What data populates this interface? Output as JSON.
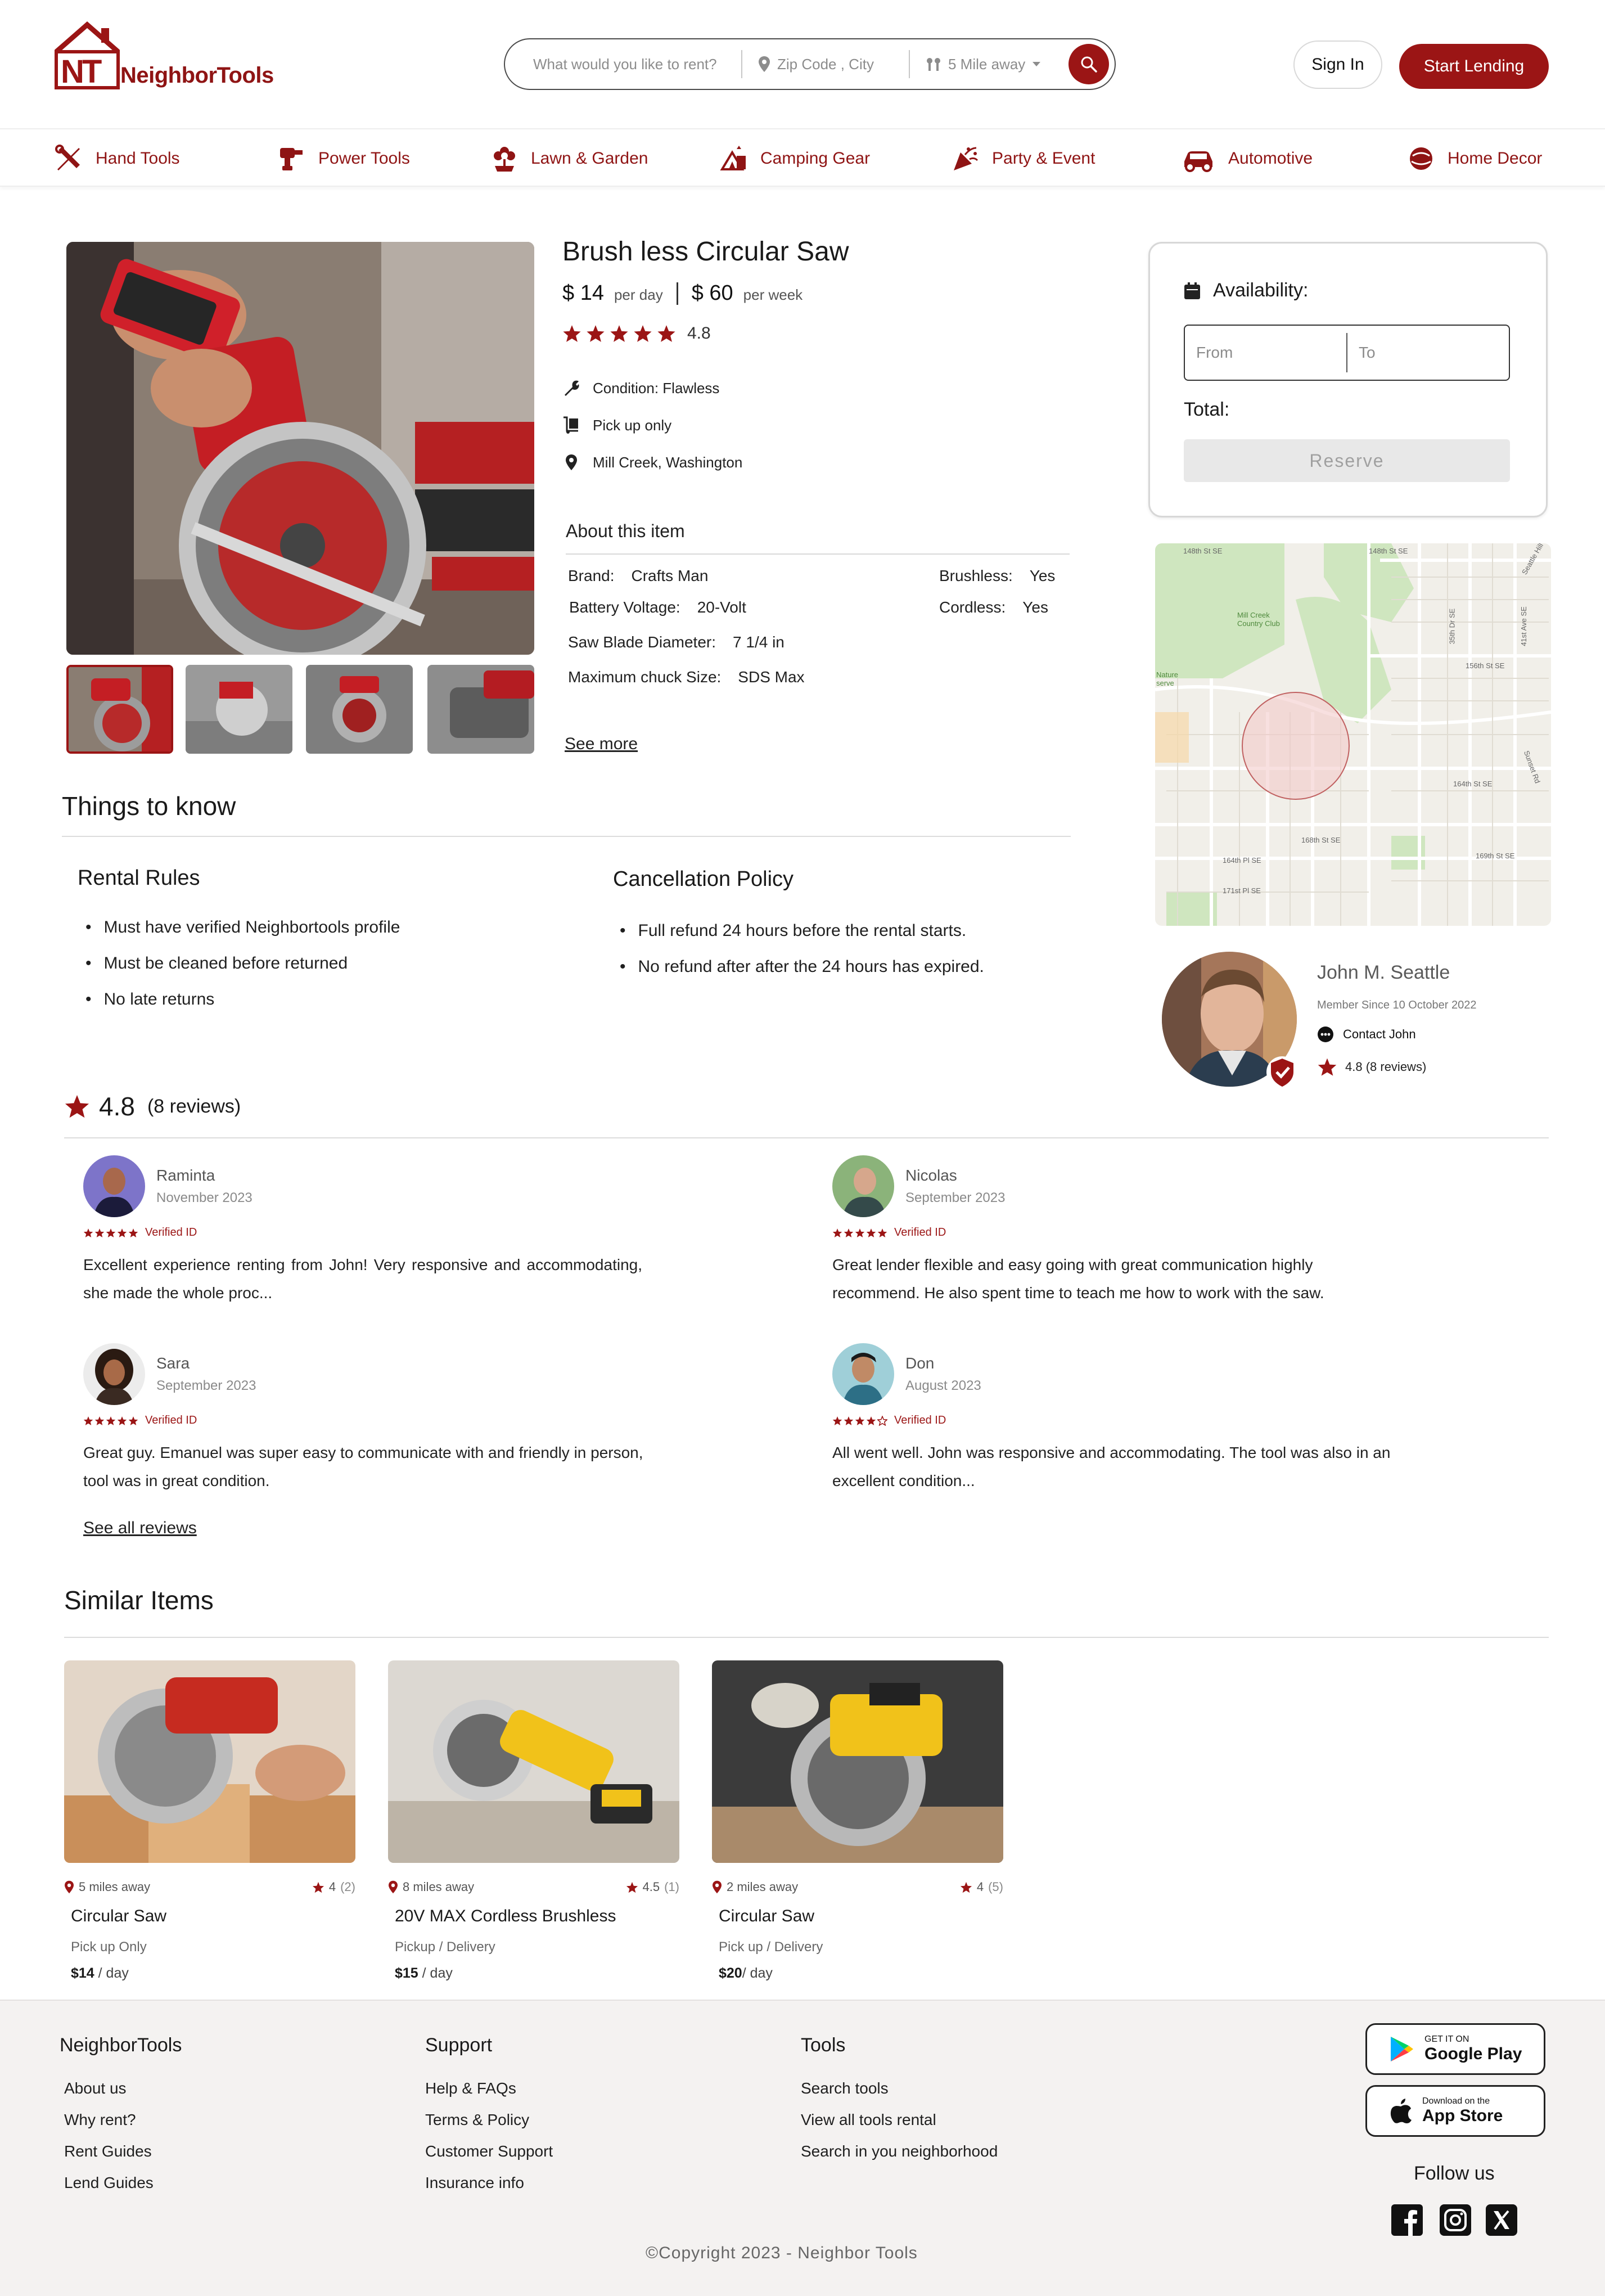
{
  "brand": {
    "logo_letters": "NT",
    "name": "NeighborTools",
    "accent": "#9b1515"
  },
  "search": {
    "what_placeholder": "What would you like to rent?",
    "location_placeholder": "Zip Code , City",
    "distance": "5 Mile away"
  },
  "header": {
    "sign_in": "Sign In",
    "start_lending": "Start Lending"
  },
  "categories": [
    {
      "label": "Hand Tools",
      "icon": "wrench-screwdriver-icon"
    },
    {
      "label": "Power Tools",
      "icon": "drill-icon"
    },
    {
      "label": "Lawn & Garden",
      "icon": "flower-icon"
    },
    {
      "label": "Camping Gear",
      "icon": "tent-icon"
    },
    {
      "label": "Party & Event",
      "icon": "party-popper-icon"
    },
    {
      "label": "Automotive",
      "icon": "car-icon"
    },
    {
      "label": "Home Decor",
      "icon": "lamp-icon"
    }
  ],
  "product": {
    "title": "Brush less Circular Saw",
    "price_day": "$ 14",
    "per_day": "per day",
    "price_week": "$ 60",
    "per_week": "per week",
    "rating": "4.8",
    "stars": 5,
    "condition": "Condition: Flawless",
    "pickup": "Pick up only",
    "location": "Mill Creek, Washington"
  },
  "about": {
    "title": "About this item",
    "specs": [
      {
        "label": "Brand:",
        "value": "Crafts Man"
      },
      {
        "label": "Battery Voltage:",
        "value": "20-Volt"
      },
      {
        "label": "Saw Blade Diameter:",
        "value": "7 1/4 in"
      },
      {
        "label": "Maximum chuck Size:",
        "value": "SDS Max"
      }
    ],
    "specs_right": [
      {
        "label": "Brushless:",
        "value": "Yes"
      },
      {
        "label": "Cordless:",
        "value": "Yes"
      }
    ],
    "see_more": "See more"
  },
  "booking": {
    "title": "Availability:",
    "from": "From",
    "to": "To",
    "total": "Total:",
    "reserve": "Reserve"
  },
  "map": {
    "streets": [
      "148th St SE",
      "148th St SE",
      "156th St SE",
      "164th St SE",
      "168th St SE",
      "169th St SE",
      "164th Pl SE",
      "171st Pl SE",
      "35th Dr SE",
      "41st Ave SE",
      "Sunset Rd",
      "Seattle Hill",
      "Mill Creek Country Club",
      "Nature serve"
    ]
  },
  "lender": {
    "name": "John M. Seattle",
    "member_since": "Member Since 10 October 2022",
    "contact": "Contact John",
    "rating": "4.8 (8 reviews)"
  },
  "things": {
    "title": "Things to know",
    "rules_title": "Rental Rules",
    "rules": [
      "Must have verified Neighbortools profile",
      "Must be cleaned before returned",
      "No late returns"
    ],
    "cancel_title": "Cancellation Policy",
    "cancel": [
      "Full refund 24 hours before the rental starts.",
      "No refund after after the 24 hours has expired."
    ]
  },
  "reviews": {
    "score": "4.8",
    "count": "(8 reviews)",
    "items": [
      {
        "name": "Raminta",
        "date": "November 2023",
        "stars": 5,
        "verified": "Verified ID",
        "text": "Excellent experience renting from John! Very responsive and accommodating, she made the whole proc..."
      },
      {
        "name": "Nicolas",
        "date": "September 2023",
        "stars": 5,
        "verified": "Verified ID",
        "text": "Great lender flexible and easy going with great communication highly recommend. He also spent time to teach me how to work with the saw."
      },
      {
        "name": "Sara",
        "date": "September 2023",
        "stars": 5,
        "verified": "Verified ID",
        "text": "Great guy.  Emanuel was super easy to communicate with and friendly in person, tool was in great condition."
      },
      {
        "name": "Don",
        "date": "August 2023",
        "stars": 4,
        "verified": "Verified ID",
        "text": "All went well. John was responsive and accommodating. The tool was also in an excellent condition..."
      }
    ],
    "see_all": "See all reviews"
  },
  "similar": {
    "title": "Similar Items",
    "items": [
      {
        "distance": "5 miles away",
        "rating": "4",
        "count": "(2)",
        "title": "Circular Saw",
        "delivery": "Pick up Only",
        "price": "$14",
        "unit": " / day"
      },
      {
        "distance": "8 miles away",
        "rating": "4.5",
        "count": "(1)",
        "title": "20V MAX Cordless Brushless",
        "delivery": "Pickup / Delivery",
        "price": "$15",
        "unit": " / day"
      },
      {
        "distance": "2 miles away",
        "rating": "4",
        "count": "(5)",
        "title": "Circular Saw",
        "delivery": "Pick up / Delivery",
        "price": "$20",
        "unit": "/ day"
      }
    ]
  },
  "footer": {
    "col1_title": "NeighborTools",
    "col1": [
      "About us",
      "Why rent?",
      "Rent  Guides",
      "Lend  Guides"
    ],
    "col2_title": "Support",
    "col2": [
      "Help & FAQs",
      "Terms & Policy",
      "Customer Support",
      "Insurance info"
    ],
    "col3_title": "Tools",
    "col3": [
      "Search tools",
      "View all tools rental",
      "Search in you neighborhood"
    ],
    "google_small": "GET IT ON",
    "google_big": "Google Play",
    "apple_small": "Download on the",
    "apple_big": "App Store",
    "follow": "Follow us",
    "copyright": "©Copyright 2023 - Neighbor Tools"
  }
}
